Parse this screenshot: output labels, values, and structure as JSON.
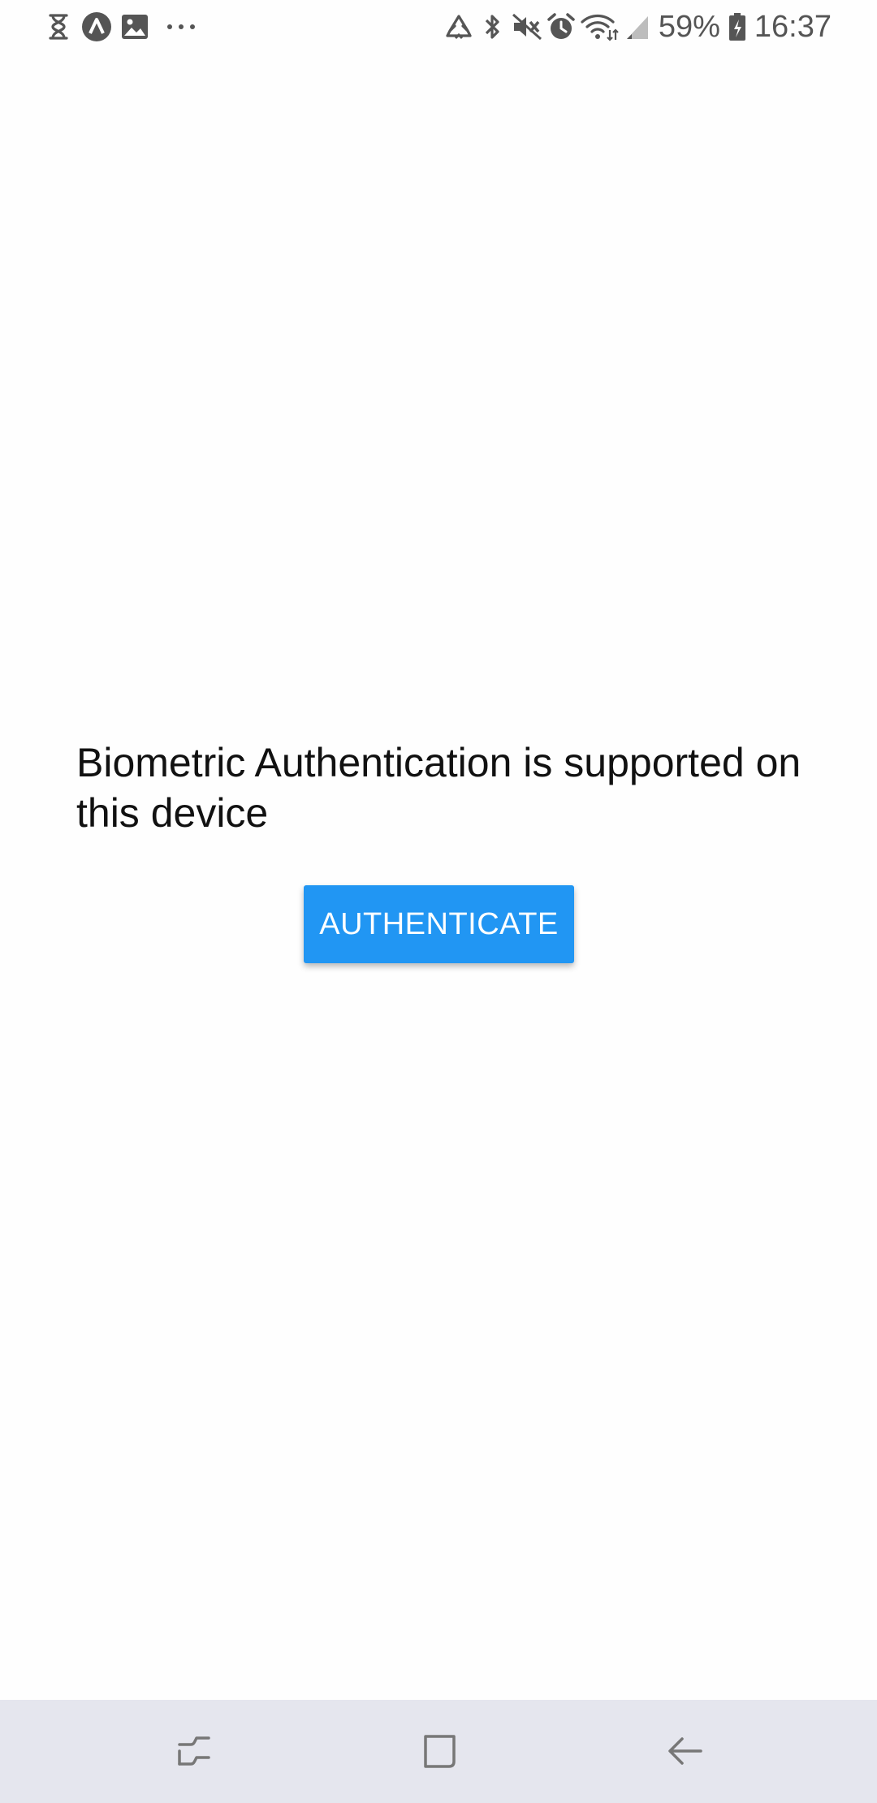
{
  "status_bar": {
    "left_icons": [
      "hourglass-icon",
      "a-circle-icon",
      "image-icon",
      "more-dots-icon"
    ],
    "right_icons": [
      "recycle-icon",
      "bluetooth-icon",
      "mute-icon",
      "alarm-icon",
      "wifi-icon",
      "signal-icon",
      "battery-icon"
    ],
    "battery_percent": "59%",
    "time": "16:37"
  },
  "main": {
    "message": "Biometric Authentication is supported on this device",
    "authenticate_label": "AUTHENTICATE",
    "button_color": "#2196f3"
  },
  "nav_bar": {
    "buttons": [
      "recent-apps-icon",
      "home-icon",
      "back-icon"
    ],
    "background": "#e5e6ee"
  }
}
